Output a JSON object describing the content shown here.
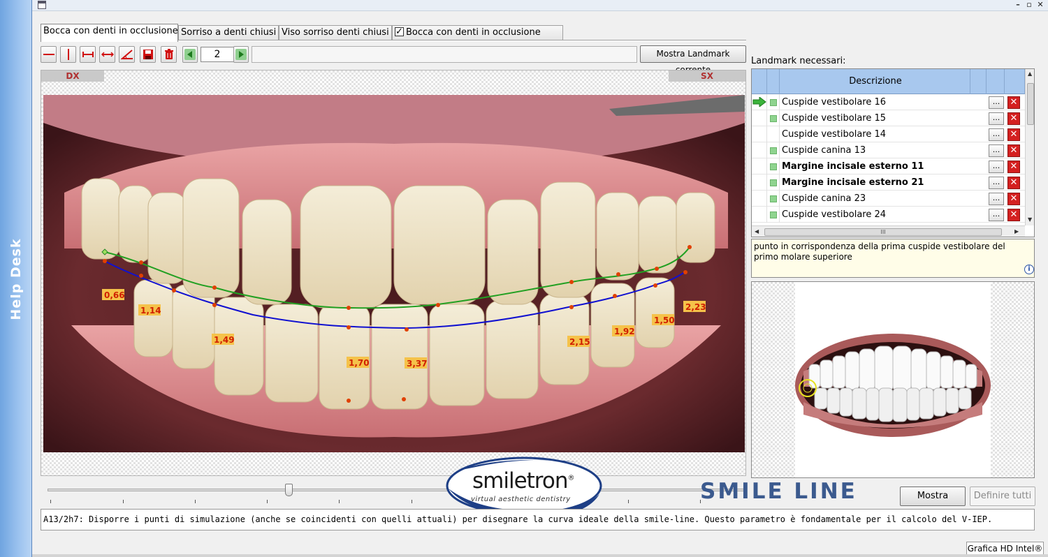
{
  "helpdesk": {
    "label": "Help Desk"
  },
  "window": {
    "minimize": "–",
    "restore": "▫",
    "close": "✕"
  },
  "tabs": [
    {
      "label": "Bocca con denti in occlusione",
      "active": true
    },
    {
      "label": "Sorriso a denti chiusi",
      "active": false
    },
    {
      "label": "Viso sorriso denti chiusi",
      "active": false
    },
    {
      "label": "Bocca con denti in occlusione",
      "active": false,
      "checked": true
    }
  ],
  "toolbar": {
    "page_value": "2",
    "landmark_button": "Mostra Landmark corrente",
    "icons": [
      "horizontal-line-icon",
      "vertical-line-icon",
      "measure-icon",
      "distance-icon",
      "angle-icon",
      "save-icon",
      "delete-icon",
      "prev-arrow-icon",
      "next-arrow-icon"
    ]
  },
  "image": {
    "left_label": "DX",
    "right_label": "SX",
    "measurements": [
      "0,66",
      "1,14",
      "1,49",
      "1,70",
      "3,37",
      "2,15",
      "1,92",
      "1,50",
      "2,23"
    ],
    "colors": {
      "ideal_curve": "#22a022",
      "current_curve": "#1010d0",
      "points": "#e04000",
      "labels_bg": "#f5c24a",
      "labels_text": "#d02000"
    }
  },
  "landmarks": {
    "title": "Landmark necessari:",
    "column_header": "Descrizione",
    "rows": [
      {
        "label": "Cuspide vestibolare 16",
        "bold": false,
        "status": true,
        "current": true
      },
      {
        "label": "Cuspide vestibolare 15",
        "bold": false,
        "status": true,
        "current": false
      },
      {
        "label": "Cuspide vestibolare 14",
        "bold": false,
        "status": false,
        "current": false
      },
      {
        "label": "Cuspide canina 13",
        "bold": false,
        "status": true,
        "current": false
      },
      {
        "label": "Margine incisale esterno 11",
        "bold": true,
        "status": true,
        "current": false
      },
      {
        "label": "Margine incisale esterno 21",
        "bold": true,
        "status": true,
        "current": false
      },
      {
        "label": "Cuspide canina 23",
        "bold": false,
        "status": true,
        "current": false
      },
      {
        "label": "Cuspide vestibolare 24",
        "bold": false,
        "status": true,
        "current": false
      }
    ],
    "row_button": "...",
    "delete_button": "✕",
    "hscroll_grip": "III"
  },
  "description": {
    "text": "punto in corrispondenza della prima cuspide vestibolare del primo molare superiore",
    "info": "i"
  },
  "slider": {
    "value": 0.34
  },
  "brand": {
    "logo_word": "smiletron",
    "registered": "®",
    "logo_tagline": "virtual aesthetic dentistry",
    "section_title": "SMILE LINE"
  },
  "buttons": {
    "show": "Mostra",
    "define_all": "Definire tutti"
  },
  "status": {
    "text": "A13/2h7: Disporre i punti di simulazione (anche se coincidenti con quelli attuali) per disegnare la curva ideale della smile-line. Questo parametro è fondamentale per il calcolo del V-IEP.",
    "graphics": "Grafica HD Intel®"
  }
}
